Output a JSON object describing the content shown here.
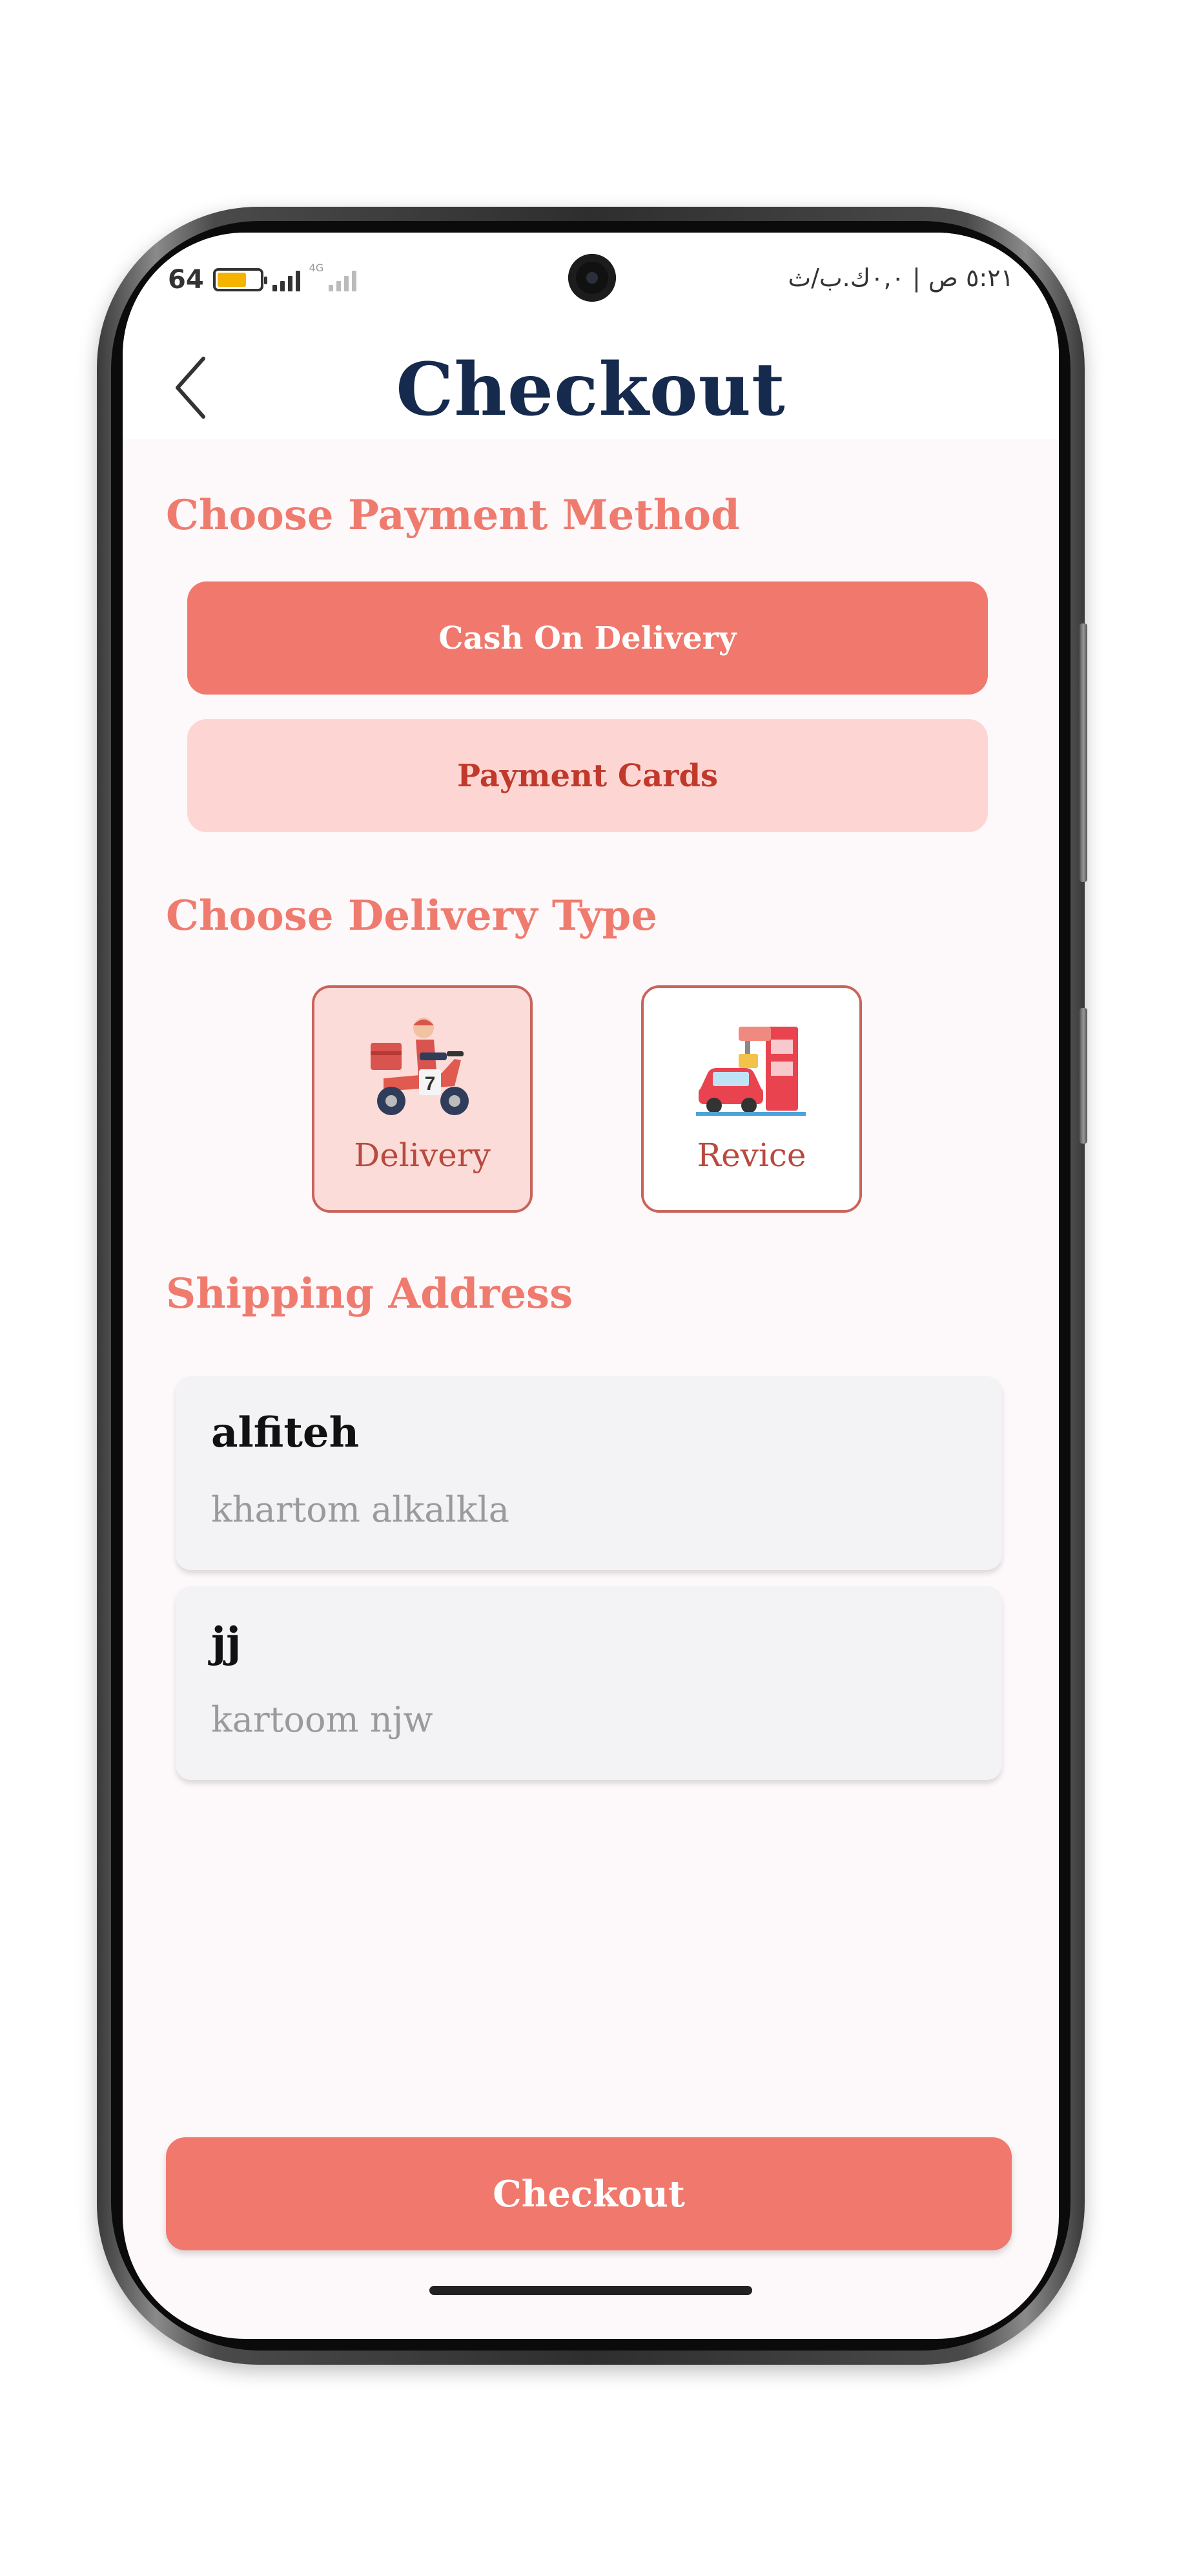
{
  "status_bar": {
    "battery_level": "64",
    "network_label": "4G",
    "time_text": "٥:٢١ ص | ٠,٠ك.ب/ث"
  },
  "header": {
    "title": "Checkout"
  },
  "payment": {
    "section_title": "Choose Payment Method",
    "methods": [
      {
        "label": "Cash On Delivery",
        "selected": true
      },
      {
        "label": "Payment Cards",
        "selected": false
      }
    ]
  },
  "delivery": {
    "section_title": "Choose Delivery Type",
    "types": [
      {
        "label": "Delivery",
        "icon": "scooter-courier-icon",
        "selected": true
      },
      {
        "label": "Revice",
        "icon": "drive-thru-icon",
        "selected": false
      }
    ]
  },
  "shipping": {
    "section_title": "Shipping Address",
    "addresses": [
      {
        "name": "alfiteh",
        "detail": "khartom alkalkla"
      },
      {
        "name": "jj",
        "detail": "kartoom njw"
      }
    ]
  },
  "checkout_button": {
    "label": "Checkout"
  },
  "colors": {
    "accent": "#f0786c",
    "accent_light": "#fdd6d3",
    "title": "#152a4d",
    "section_title": "#ef7b6f"
  }
}
